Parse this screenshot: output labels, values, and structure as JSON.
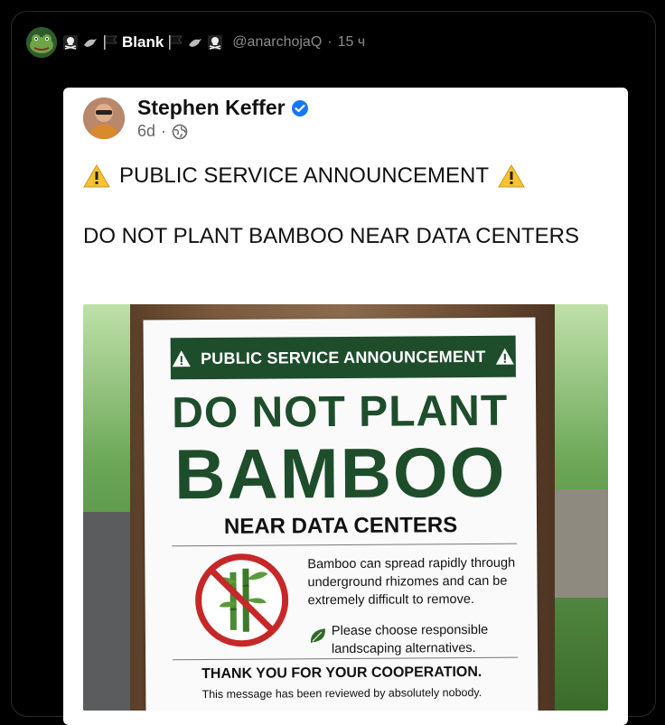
{
  "tweet": {
    "author_name": "Blank",
    "author_prefix_icons": [
      "skull-crossbones-icon",
      "crow-icon",
      "black-flag-icon"
    ],
    "author_suffix_icons": [
      "black-flag-icon",
      "crow-icon",
      "skull-crossbones-icon"
    ],
    "handle": "@anarchojaQ",
    "separator": "·",
    "timestamp": "15 ч"
  },
  "embedded_post": {
    "author_name": "Stephen Keffer",
    "verified": true,
    "age": "6d",
    "meta_separator": "·",
    "psa_text": "PUBLIC SERVICE ANNOUNCEMENT",
    "body_text": "DO NOT PLANT BAMBOO NEAR DATA CENTERS"
  },
  "poster": {
    "banner": "PUBLIC SERVICE ANNOUNCEMENT",
    "headline_1": "DO NOT PLANT",
    "headline_2": "BAMBOO",
    "headline_3": "NEAR DATA CENTERS",
    "info_1": "Bamboo can spread rapidly through underground rhizomes and can be extremely difficult to remove.",
    "info_2": "Please choose responsible landscaping alternatives.",
    "thanks": "THANK YOU FOR YOUR COOPERATION.",
    "footer": "This message has been reviewed by absolutely nobody."
  },
  "colors": {
    "poster_green": "#1e4d2b",
    "verified_blue": "#1877f2",
    "warning_yellow": "#f7c32e",
    "prohibited_red": "#c62828"
  }
}
